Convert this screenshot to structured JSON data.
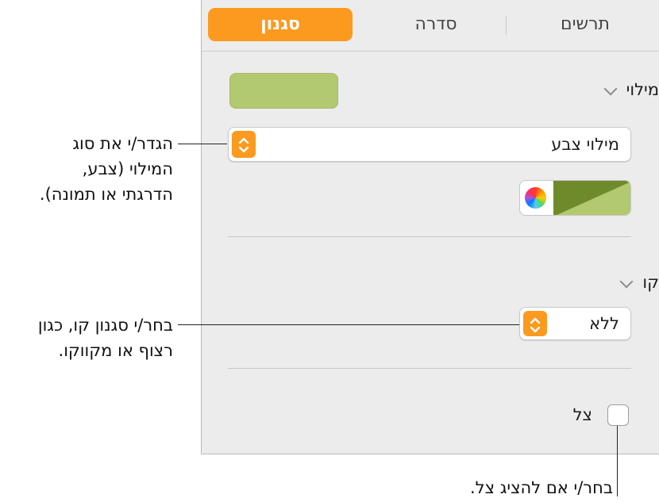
{
  "tabs": [
    {
      "label": "סגנון",
      "active": true
    },
    {
      "label": "סדרה",
      "active": false
    },
    {
      "label": "תרשים",
      "active": false
    }
  ],
  "fill": {
    "header": "מילוי",
    "swatch_color": "#b3c96f",
    "type_value": "מילוי צבע",
    "gradient_colors": [
      "#6e8a2b",
      "#b3c96f"
    ]
  },
  "line": {
    "header": "קו",
    "style_value": "ללא"
  },
  "shadow": {
    "label": "צל",
    "checked": false
  },
  "callouts": {
    "fill_type": [
      "הגדר/י את סוג",
      "המילוי (צבע,",
      "הדרגתי או תמונה)."
    ],
    "line_style": [
      "בחר/י סגנון קו, כגון",
      "רצוף או מקווקו."
    ],
    "shadow": [
      "בחר/י אם להציג צל."
    ]
  },
  "colors": {
    "accent": "#fb9a1f",
    "panel_bg": "#ececec"
  }
}
